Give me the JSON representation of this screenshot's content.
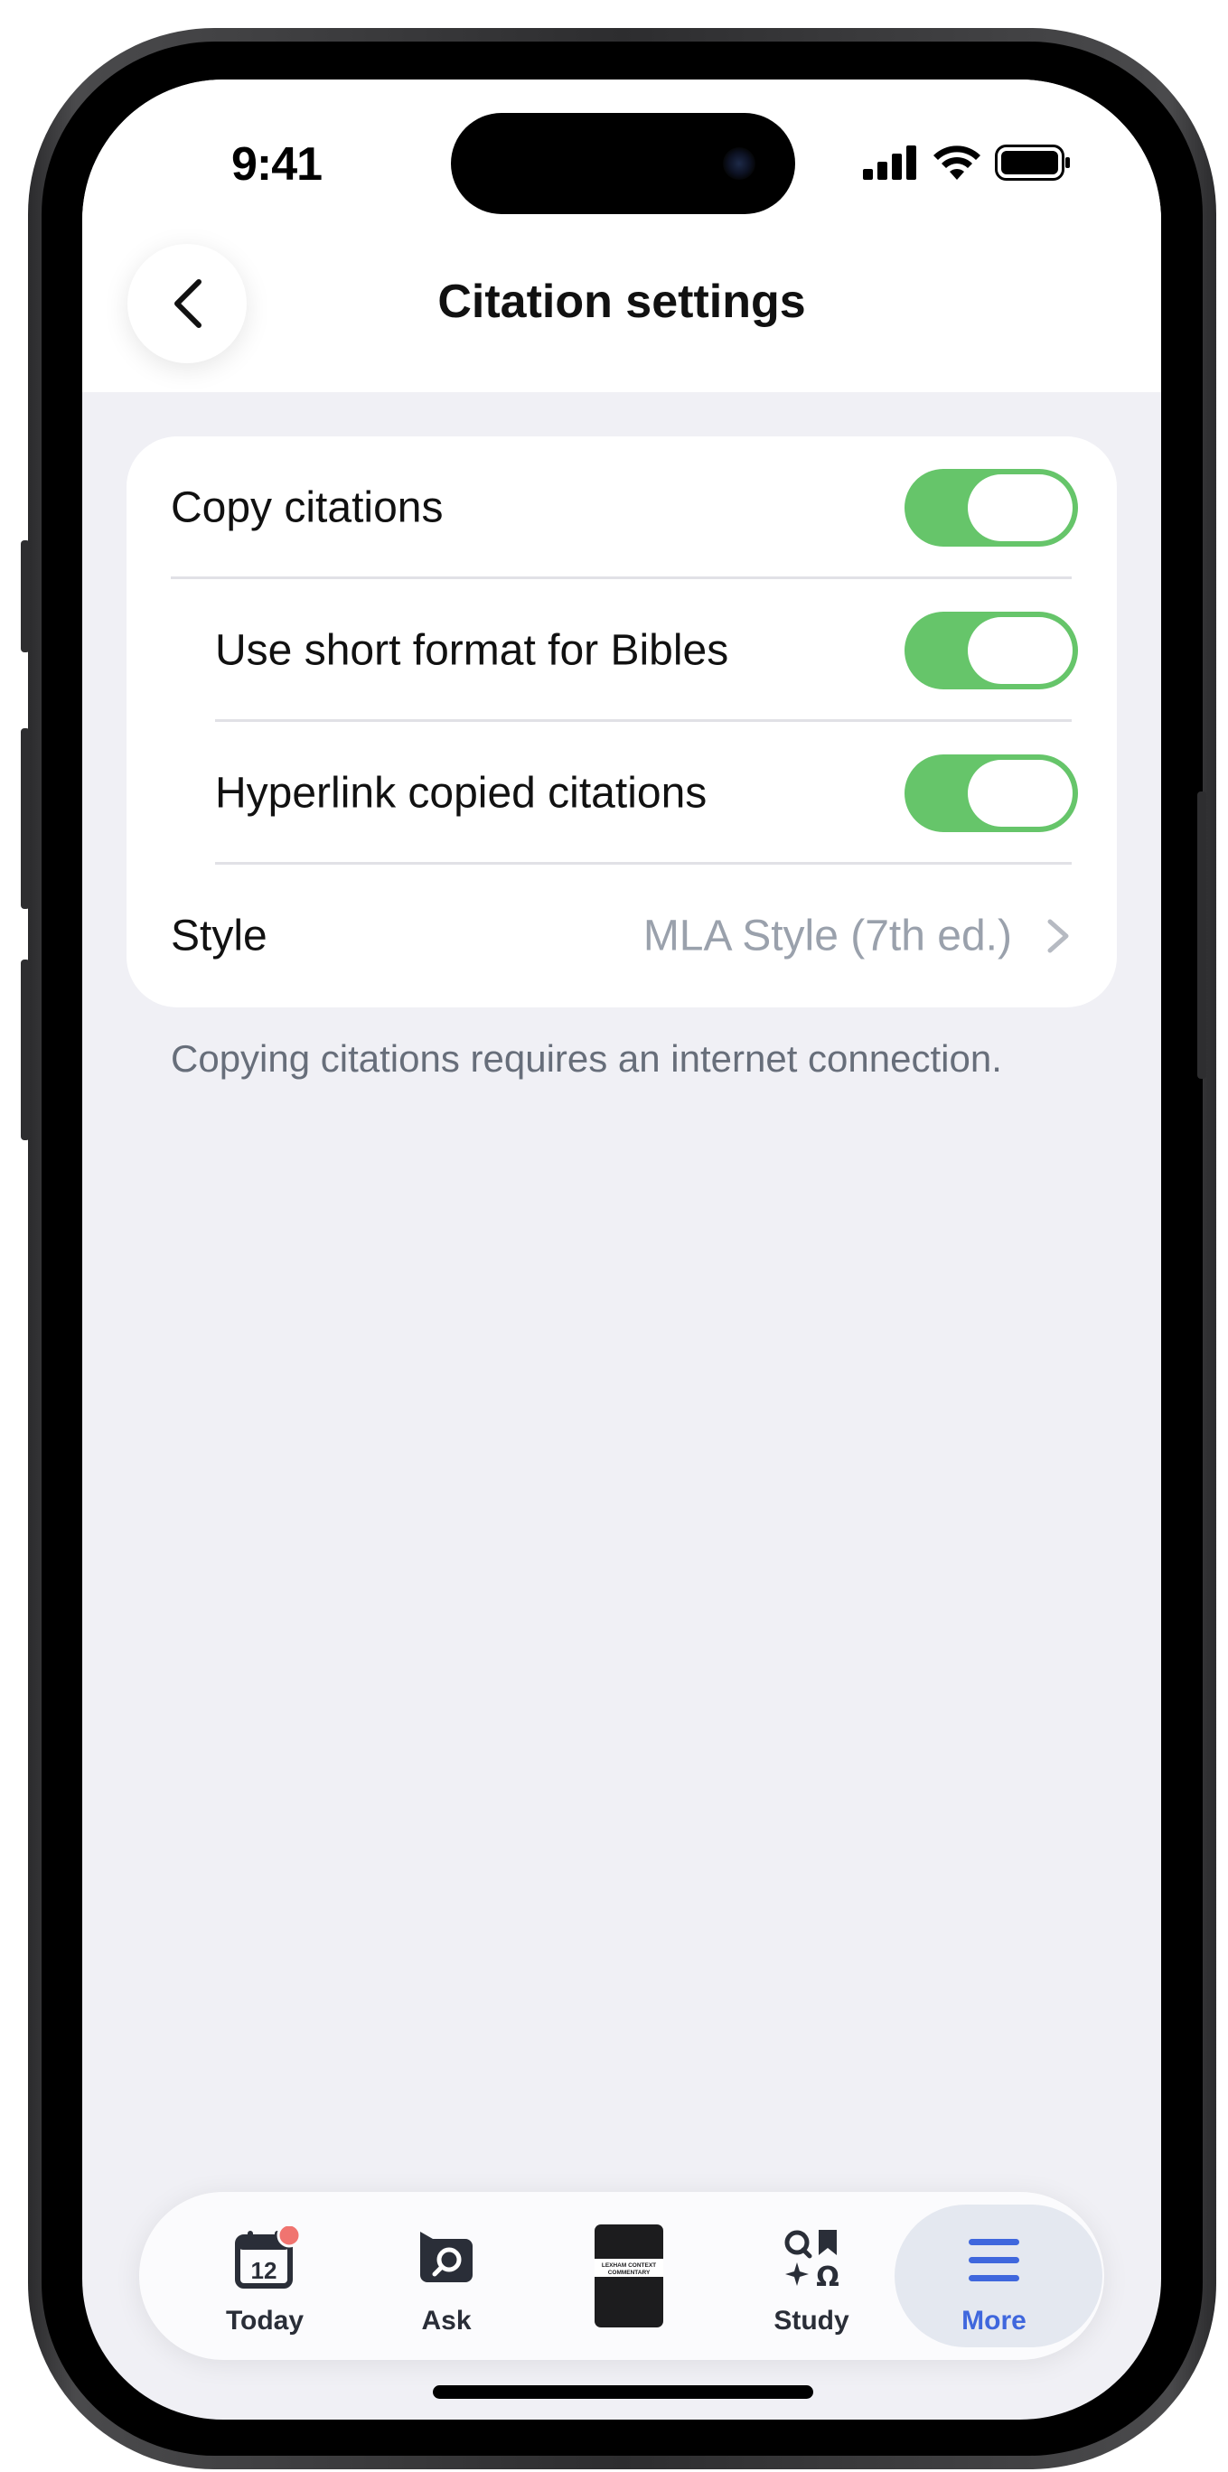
{
  "status_bar": {
    "time": "9:41"
  },
  "header": {
    "title": "Citation settings"
  },
  "settings": {
    "copy_citations": {
      "label": "Copy citations",
      "on": true
    },
    "short_format": {
      "label": "Use short format for Bibles",
      "on": true
    },
    "hyperlink": {
      "label": "Hyperlink copied citations",
      "on": true
    },
    "style": {
      "label": "Style",
      "value": "MLA Style (7th ed.)"
    }
  },
  "footnote": "Copying citations requires an internet connection.",
  "tabbar": {
    "items": [
      {
        "label": "Today",
        "icon": "calendar-icon",
        "badge_color": "#f07470"
      },
      {
        "label": "Ask",
        "icon": "chat-search-icon"
      },
      {
        "label": "",
        "icon": "book-cover-icon",
        "cover_text": [
          "LEXHAM CONTEXT",
          "COMMENTARY"
        ]
      },
      {
        "label": "Study",
        "icon": "study-icon"
      },
      {
        "label": "More",
        "icon": "menu-icon",
        "active": true
      }
    ]
  },
  "colors": {
    "toggle_on": "#66c56a",
    "accent": "#3f67dd",
    "background": "#f0f0f5"
  }
}
